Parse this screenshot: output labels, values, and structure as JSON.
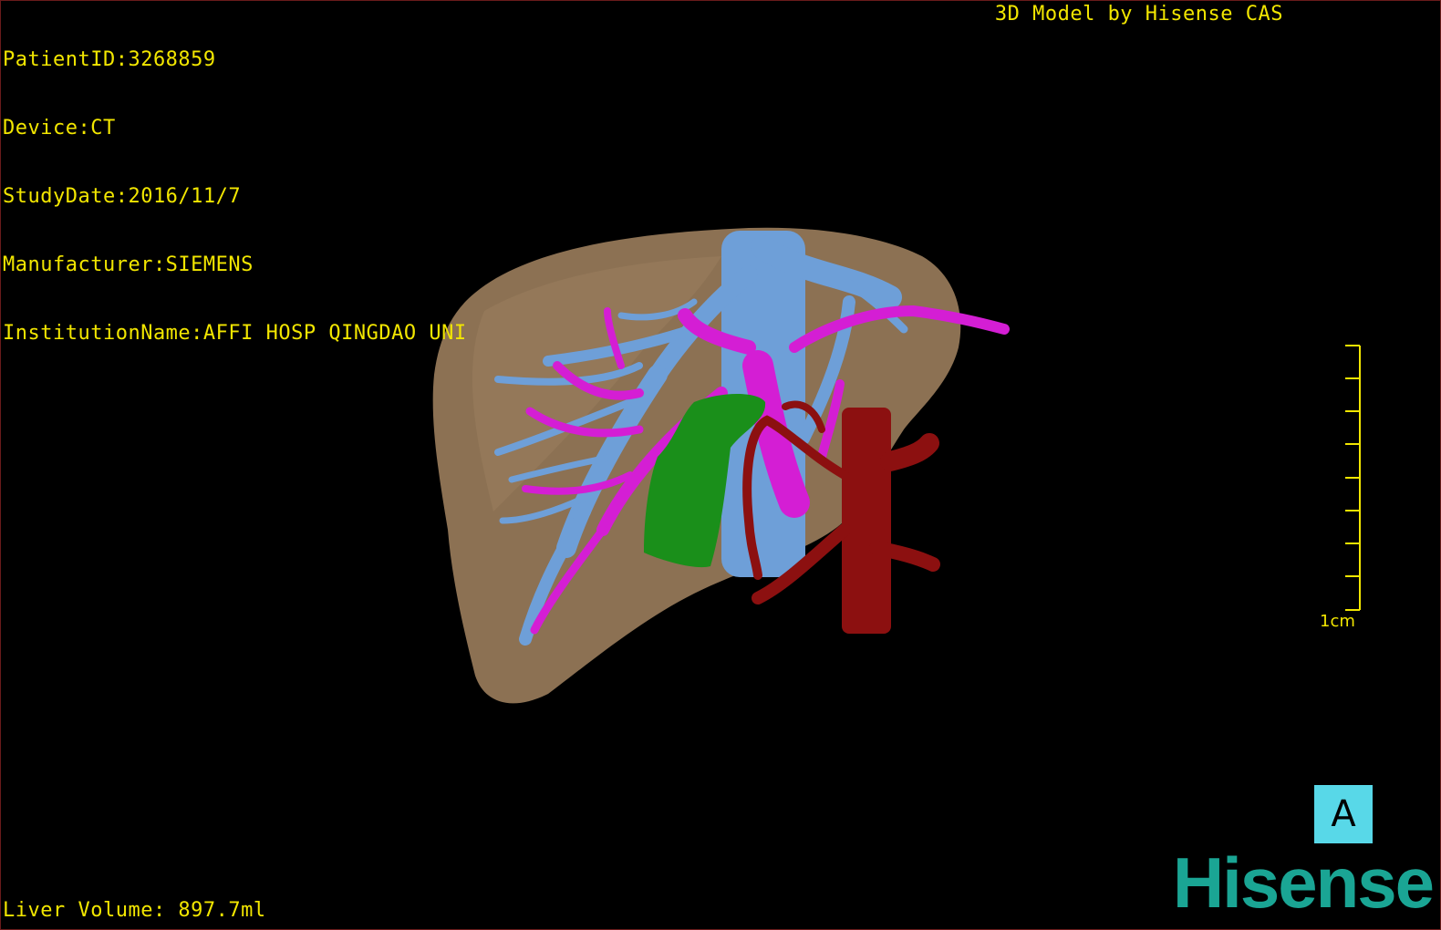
{
  "patient_info": {
    "patient_id": "PatientID:3268859",
    "device": "Device:CT",
    "study_date": "StudyDate:2016/11/7",
    "manufacturer": "Manufacturer:SIEMENS",
    "institution": "InstitutionName:AFFI HOSP QINGDAO UNI"
  },
  "header": {
    "caption": "3D Model by Hisense CAS"
  },
  "footer": {
    "liver_volume": "Liver Volume: 897.7ml"
  },
  "scale": {
    "label": "1cm"
  },
  "orientation": {
    "label": "A"
  },
  "brand": {
    "logo": "Hisense",
    "logo_color": "#1aa594"
  },
  "overlay_color": "#f2e600",
  "model_colors": {
    "liver": "#8c7153",
    "hepatic_vein": "#6e9fd8",
    "portal_vein": "#d41ed4",
    "artery_aorta": "#8c1010",
    "tumor": "#1a8f1a"
  }
}
